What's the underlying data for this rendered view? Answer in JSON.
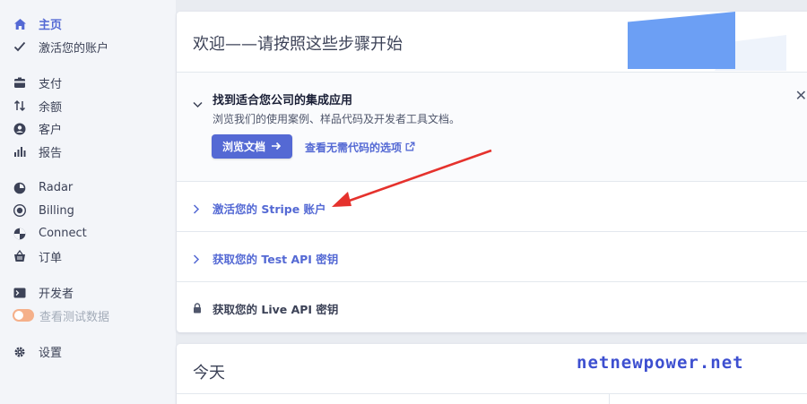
{
  "sidebar": {
    "items": [
      {
        "label": "主页",
        "icon": "home-icon",
        "active": true
      },
      {
        "label": "激活您的账户",
        "icon": "check-icon"
      },
      {
        "label": "支付",
        "icon": "payments-icon"
      },
      {
        "label": "余额",
        "icon": "balance-icon"
      },
      {
        "label": "客户",
        "icon": "customer-icon"
      },
      {
        "label": "报告",
        "icon": "report-icon"
      },
      {
        "label": "Radar",
        "icon": "radar-icon"
      },
      {
        "label": "Billing",
        "icon": "billing-icon"
      },
      {
        "label": "Connect",
        "icon": "connect-icon"
      },
      {
        "label": "订单",
        "icon": "orders-icon"
      },
      {
        "label": "开发者",
        "icon": "terminal-icon"
      },
      {
        "label": "查看测试数据",
        "icon": "toggle-icon"
      },
      {
        "label": "设置",
        "icon": "gear-icon"
      }
    ]
  },
  "welcome": {
    "title": "欢迎——请按照这些步骤开始",
    "open_step": {
      "title": "找到适合您公司的集成应用",
      "desc": "浏览我们的使用案例、样品代码及开发者工具文档。",
      "primary_btn": "浏览文档",
      "link": "查看无需代码的选项"
    },
    "steps": [
      {
        "label": "激活您的 Stripe 账户"
      },
      {
        "label": "获取您的 Test API 密钥"
      },
      {
        "label": "获取您的 Live API 密钥"
      }
    ]
  },
  "today": {
    "title": "今天"
  },
  "watermark": "netnewpower.net",
  "colors": {
    "accent": "#5469d4",
    "arrow": "#e5322d",
    "toggle": "#f5b08a"
  }
}
